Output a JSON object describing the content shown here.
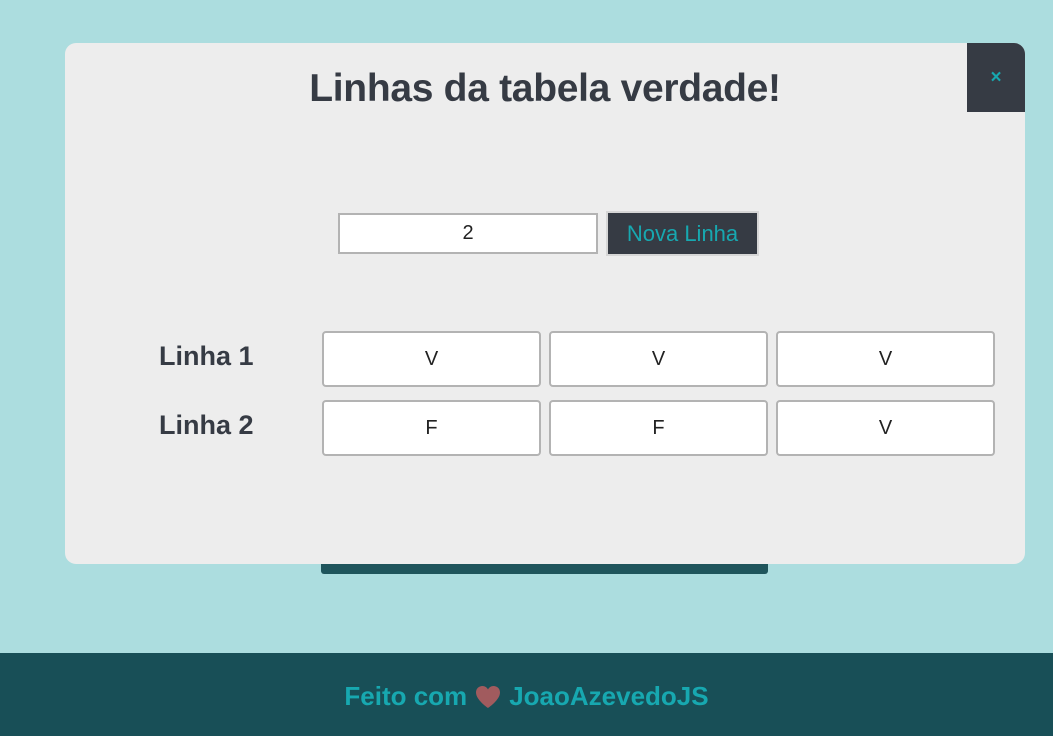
{
  "modal": {
    "title": "Linhas da tabela verdade!",
    "close_label": "×",
    "row_count_value": "2",
    "new_row_label": "Nova Linha",
    "rows": [
      {
        "label": "Linha 1",
        "cells": [
          "V",
          "V",
          "V"
        ]
      },
      {
        "label": "Linha 2",
        "cells": [
          "F",
          "F",
          "V"
        ]
      }
    ]
  },
  "footer": {
    "prefix": "Feito com",
    "heart_icon": "heart-icon",
    "author": "JoaoAzevedoJS"
  },
  "colors": {
    "background": "#acdddf",
    "modal_background": "#ededed",
    "dark": "#363b44",
    "accent": "#17a8b0",
    "footer": "#184f57",
    "heart": "#a15b5e"
  }
}
